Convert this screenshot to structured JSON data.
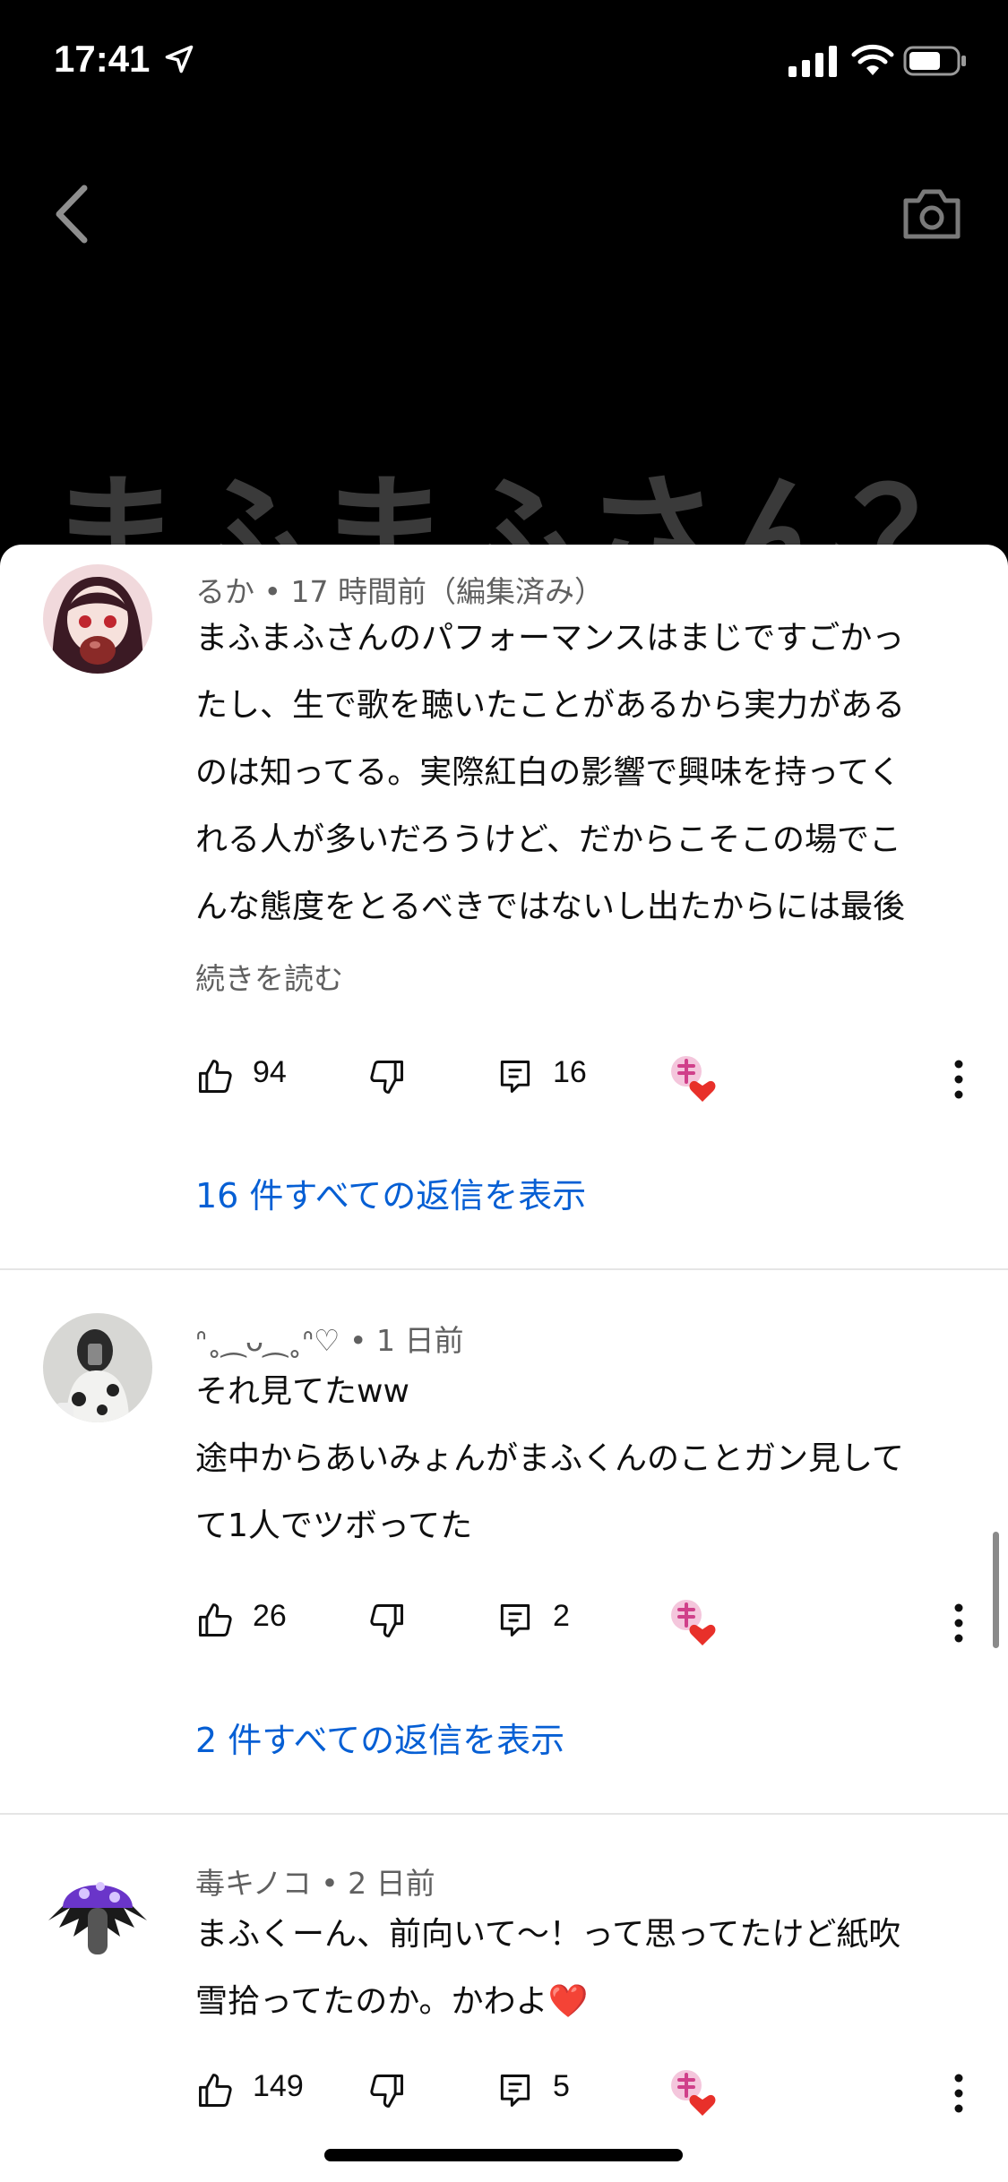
{
  "status": {
    "time": "17:41"
  },
  "background_title": "まふまふさん？",
  "comments": [
    {
      "author": "るか",
      "time": "17 時間前（編集済み）",
      "lines": [
        "まふまふさんのパフォーマンスはまじですごかっ",
        "たし、生で歌を聴いたことがあるから実力がある",
        "のは知ってる。実際紅白の影響で興味を持ってく",
        "れる人が多いだろうけど、だからこそこの場でこ",
        "んな態度をとるべきではないし出たからには最後"
      ],
      "read_more": "続きを読む",
      "likes": "94",
      "reply_count": "16",
      "replies_link": "16 件すべての返信を表示"
    },
    {
      "author": "ᐢ˳⁔ᴗ⁔˳ᐢ♡",
      "time": "1 日前",
      "lines": [
        "それ見てたww",
        "途中からあいみょんがまふくんのことガン見して",
        "て1人でツボってた"
      ],
      "likes": "26",
      "reply_count": "2",
      "replies_link": "2 件すべての返信を表示"
    },
    {
      "author": "毒キノコ",
      "time": "2 日前",
      "lines": [
        "まふくーん、前向いて〜！って思ってたけど紙吹",
        "雪拾ってたのか。かわよ❤️"
      ],
      "likes": "149",
      "reply_count": "5"
    }
  ],
  "colors": {
    "link": "#065fd4",
    "meta": "#606060",
    "heart": "#e8302a"
  }
}
